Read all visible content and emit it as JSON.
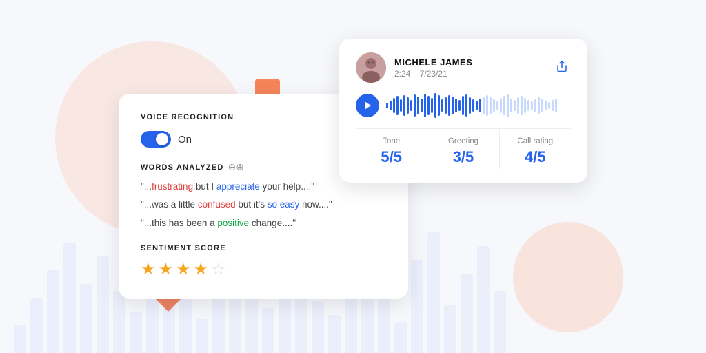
{
  "background": {
    "bars": [
      40,
      80,
      120,
      160,
      100,
      140,
      90,
      60,
      110,
      150,
      80,
      50,
      130,
      170,
      95,
      65,
      145,
      120,
      75,
      55,
      100,
      160,
      85,
      45,
      135,
      175,
      70,
      115,
      155,
      90
    ]
  },
  "audio_card": {
    "name": "MICHELE JAMES",
    "time": "2:24",
    "date": "7/23/21",
    "metrics": [
      {
        "label": "Tone",
        "value": "5/5"
      },
      {
        "label": "Greeting",
        "value": "3/5"
      },
      {
        "label": "Call rating",
        "value": "4/5"
      }
    ]
  },
  "voice_card": {
    "section_title": "VOICE RECOGNITION",
    "toggle_label": "On",
    "words_title": "WORDS ANALYZED",
    "quotes": [
      {
        "parts": [
          {
            "text": "\"..."
          },
          {
            "text": "frustrating",
            "color": "red"
          },
          {
            "text": " but I "
          },
          {
            "text": "appreciate",
            "color": "blue"
          },
          {
            "text": " your help....\""
          }
        ]
      },
      {
        "parts": [
          {
            "text": "\"...was a little "
          },
          {
            "text": "confused",
            "color": "red"
          },
          {
            "text": " but it's "
          },
          {
            "text": "so easy",
            "color": "blue"
          },
          {
            "text": " now....\""
          }
        ]
      },
      {
        "parts": [
          {
            "text": "\"...this has been a "
          },
          {
            "text": "positive",
            "color": "green"
          },
          {
            "text": " change....\""
          }
        ]
      }
    ],
    "sentiment_title": "SENTIMENT SCORE",
    "stars": [
      true,
      true,
      true,
      true,
      false
    ]
  }
}
